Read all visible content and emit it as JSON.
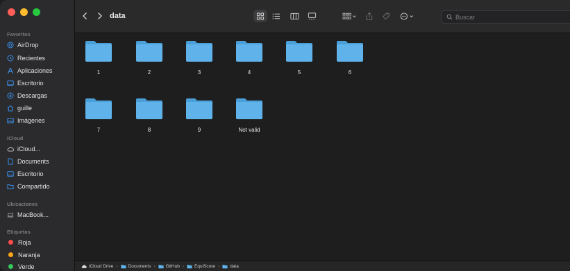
{
  "window": {
    "title": "data"
  },
  "colors": {
    "accent": "#3b82f6",
    "folder": "#5fb3ea",
    "folder_tab": "#4a9fd8",
    "icon_blue": "#3a8ee6",
    "tag_red": "#ff4b4b",
    "tag_orange": "#ffa51a",
    "tag_green": "#34c759"
  },
  "sidebar": {
    "favorites_heading": "Favoritos",
    "favorites": [
      {
        "label": "AirDrop",
        "icon": "airdrop-icon"
      },
      {
        "label": "Recientes",
        "icon": "clock-icon"
      },
      {
        "label": "Aplicaciones",
        "icon": "apps-icon"
      },
      {
        "label": "Escritorio",
        "icon": "desktop-icon"
      },
      {
        "label": "Descargas",
        "icon": "download-icon"
      },
      {
        "label": "guille",
        "icon": "home-icon"
      },
      {
        "label": "Imágenes",
        "icon": "photo-icon"
      }
    ],
    "icloud_heading": "iCloud",
    "icloud": [
      {
        "label": "iCloud...",
        "icon": "cloud-icon"
      },
      {
        "label": "Documents",
        "icon": "document-icon"
      },
      {
        "label": "Escritorio",
        "icon": "desktop-icon"
      },
      {
        "label": "Compartido",
        "icon": "shared-folder-icon"
      }
    ],
    "locations_heading": "Ubicaciones",
    "locations": [
      {
        "label": "MacBook...",
        "icon": "laptop-icon"
      }
    ],
    "tags_heading": "Etiquetas",
    "tags": [
      {
        "label": "Roja",
        "color": "#ff4b4b"
      },
      {
        "label": "Naranja",
        "color": "#ffa51a"
      },
      {
        "label": "Verde",
        "color": "#34c759"
      }
    ]
  },
  "toolbar": {
    "search_placeholder": "Buscar"
  },
  "folders": [
    {
      "name": "1"
    },
    {
      "name": "2"
    },
    {
      "name": "3"
    },
    {
      "name": "4"
    },
    {
      "name": "5"
    },
    {
      "name": "6"
    },
    {
      "name": "7"
    },
    {
      "name": "8"
    },
    {
      "name": "9"
    },
    {
      "name": "Not valid"
    }
  ],
  "pathbar": {
    "crumbs": [
      "iCloud Drive",
      "Documents",
      "GitHub",
      "EquiScore",
      "data"
    ]
  }
}
